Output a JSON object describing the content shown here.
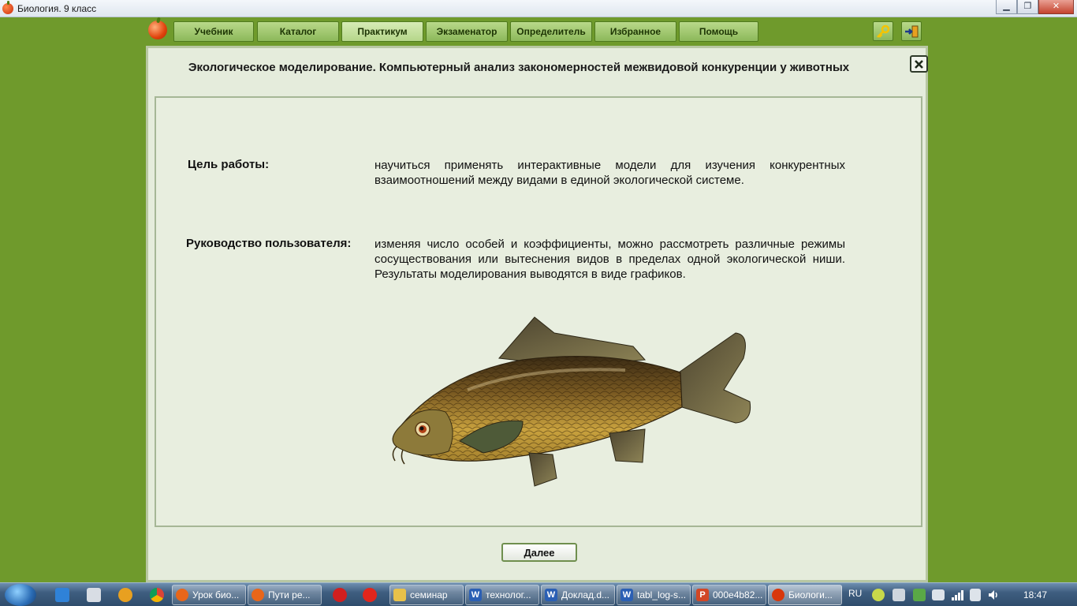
{
  "window": {
    "title": "Биология. 9 класс",
    "controls": {
      "minimize": "▁",
      "maximize": "❐",
      "close": "✕"
    }
  },
  "menu": {
    "tabs": [
      {
        "label": "Учебник"
      },
      {
        "label": "Каталог"
      },
      {
        "label": "Практикум"
      },
      {
        "label": "Экзаменатор"
      },
      {
        "label": "Определитель"
      },
      {
        "label": "Избранное"
      },
      {
        "label": "Помощь"
      }
    ],
    "active_tab": "Практикум",
    "icons": [
      "key-icon",
      "exit-icon"
    ]
  },
  "panel": {
    "title": "Экологическое моделирование. Компьютерный анализ закономерностей межвидовой конкуренции у животных",
    "goal_label": "Цель работы:",
    "goal_text": "научиться применять интерактивные модели для изучения конкурентных взаимоотношений между видами в единой экологической системе.",
    "guide_label": "Руководство пользователя:",
    "guide_text": "изменяя число особей и коэффициенты, можно рассмотреть различные режимы сосуществования или вытеснения видов в пределах одной экологической ниши. Результаты моделирования выводятся в виде графиков.",
    "image": "carp-fish-illustration",
    "next_button": "Далее"
  },
  "taskbar": {
    "items": [
      {
        "label": "Урок био...",
        "icon": "firefox-icon"
      },
      {
        "label": "Пути ре...",
        "icon": "firefox-icon"
      },
      {
        "label": "семинар",
        "icon": "folder-icon"
      },
      {
        "label": "технолог...",
        "icon": "word-icon"
      },
      {
        "label": "Доклад.d...",
        "icon": "word-icon"
      },
      {
        "label": "tabl_log-s...",
        "icon": "word-icon"
      },
      {
        "label": "000e4b82...",
        "icon": "powerpoint-icon"
      },
      {
        "label": "Биологи...",
        "icon": "apple-icon"
      }
    ],
    "language": "RU",
    "clock": "18:47"
  },
  "colors": {
    "desktop": "#6f9a2c",
    "panel": "#e5ecdc",
    "tab": "#a6cc72"
  }
}
